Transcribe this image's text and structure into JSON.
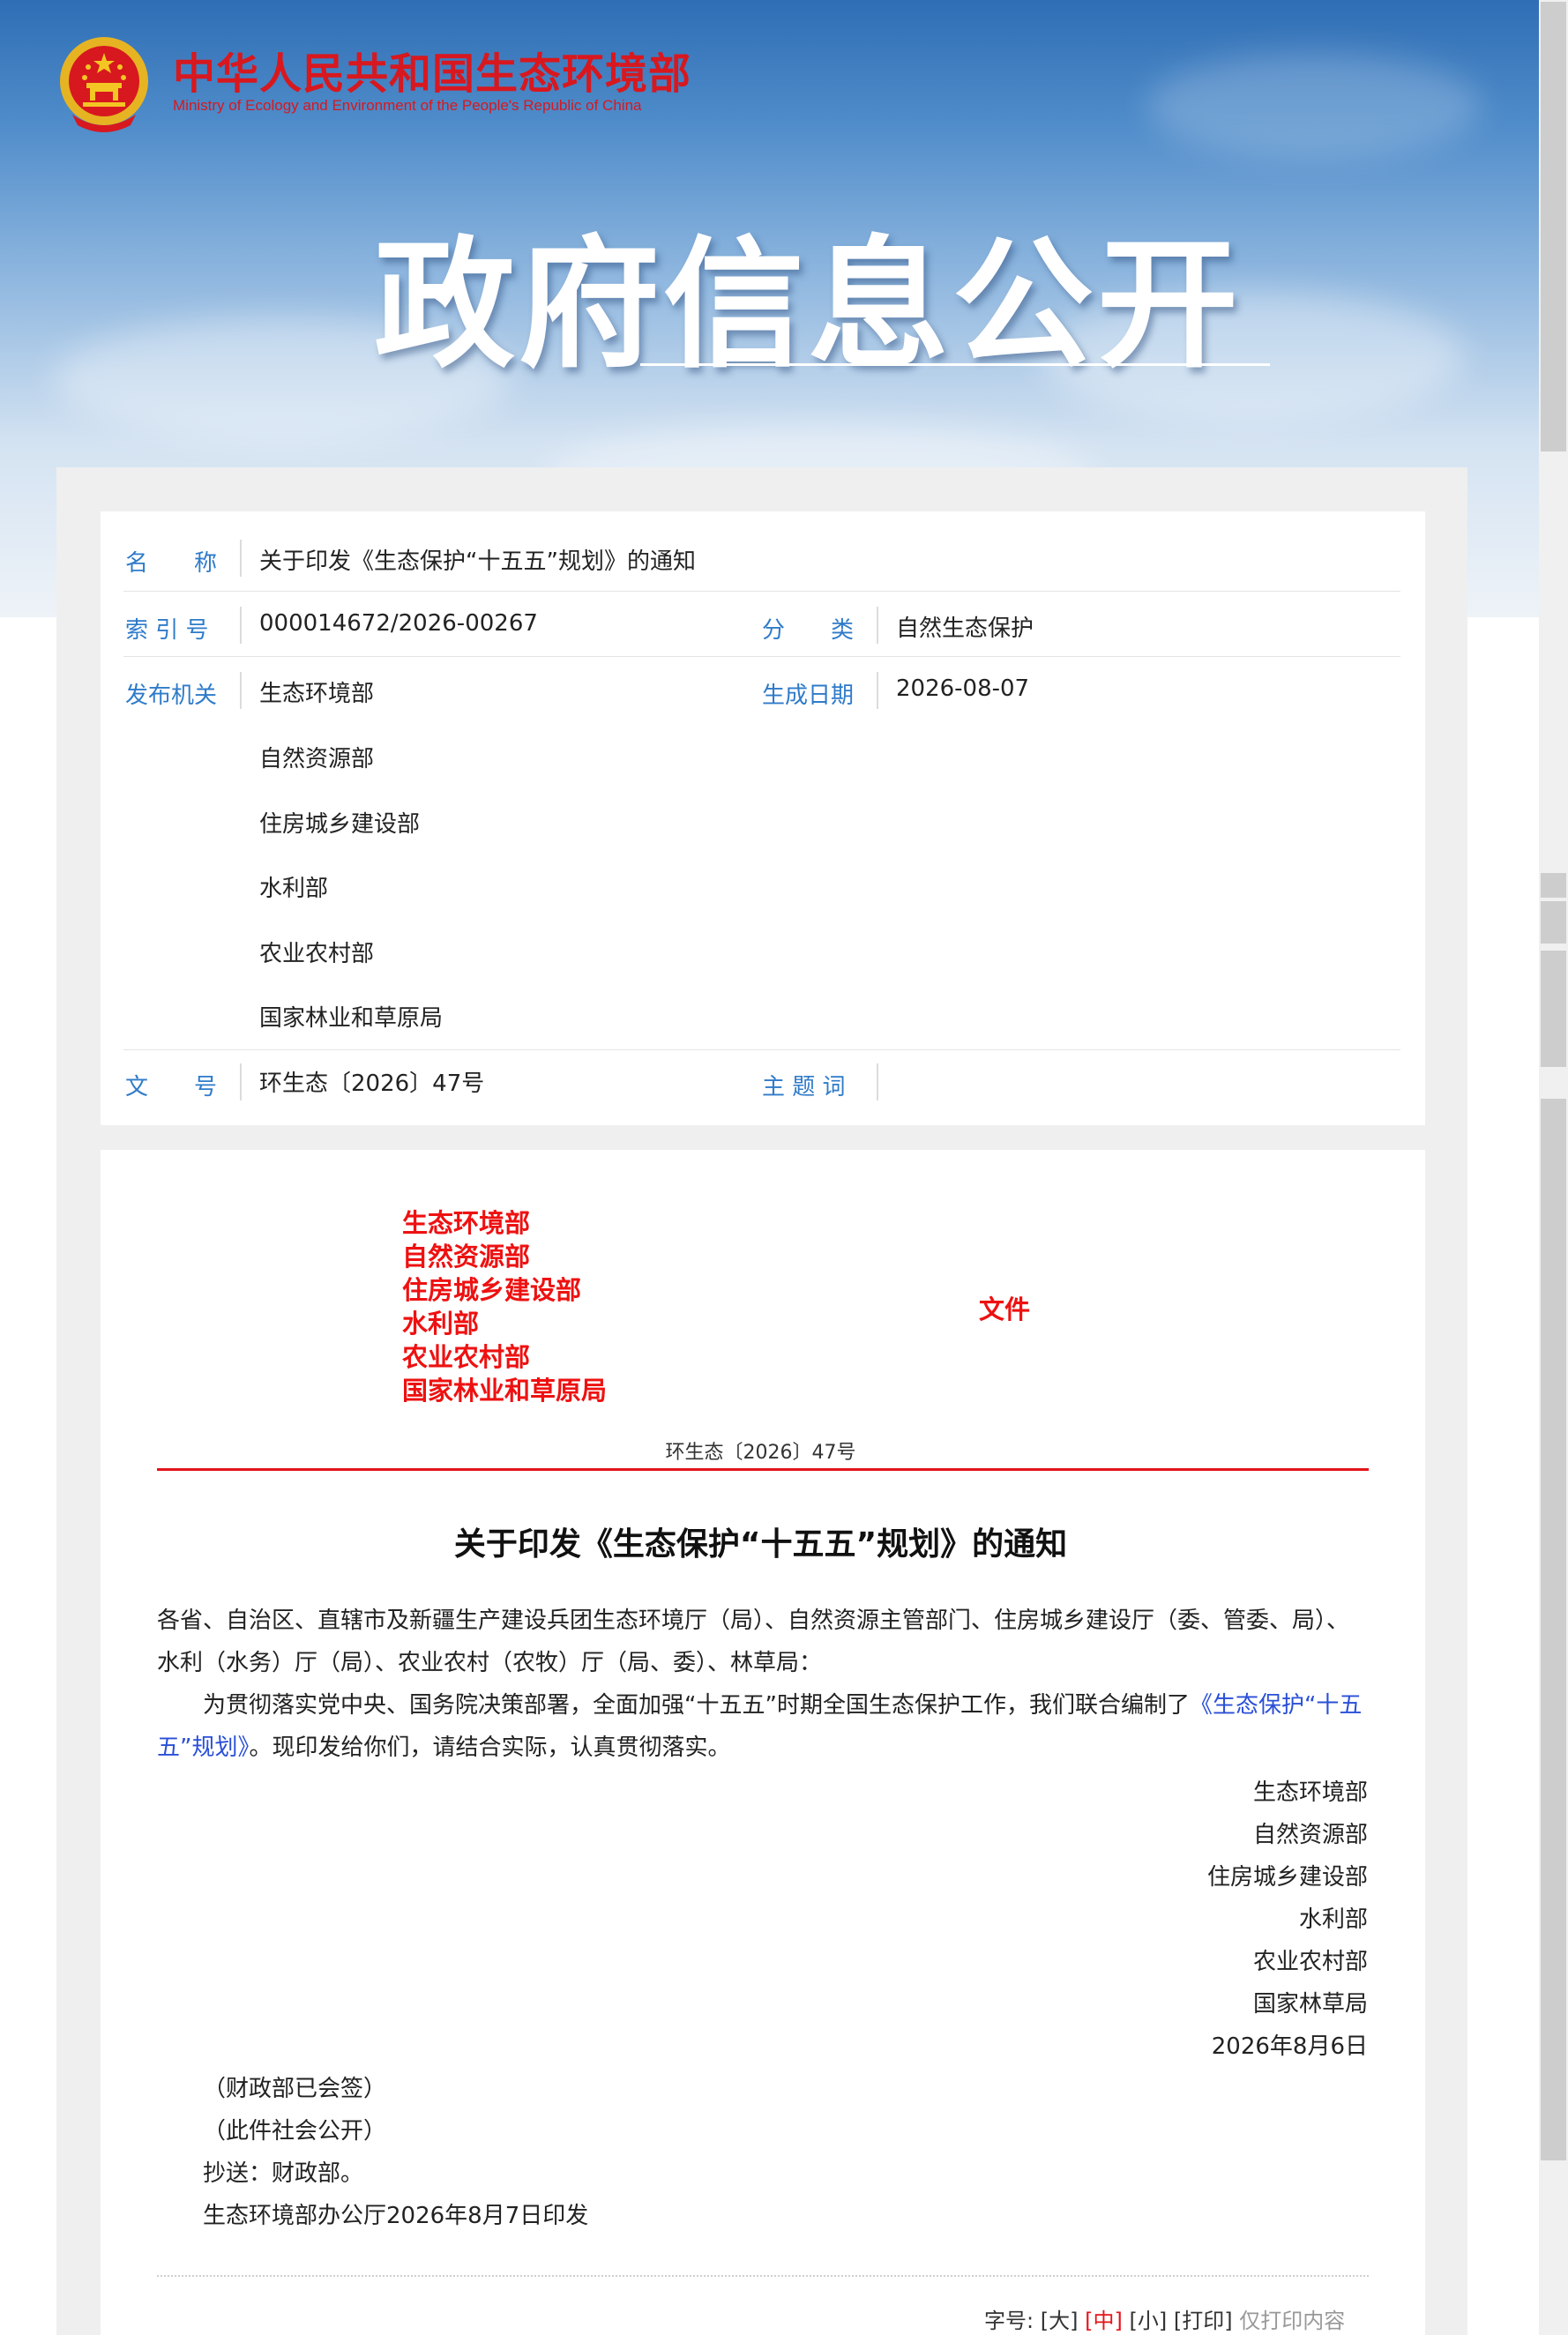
{
  "header": {
    "ministry_cn": "中华人民共和国生态环境部",
    "ministry_en": "Ministry of Ecology and Environment of the People's Republic of China",
    "hero_title": "政府信息公开"
  },
  "meta": {
    "name_label": "名　　称",
    "name_value": "关于印发《生态保护“十五五”规划》的通知",
    "index_label": "索 引 号",
    "index_value": "000014672/2026-00267",
    "category_label": "分　　类",
    "category_value": "自然生态保护",
    "issuer_label": "发布机关",
    "issuers": [
      "生态环境部",
      "自然资源部",
      "住房城乡建设部",
      "水利部",
      "农业农村部",
      "国家林业和草原局"
    ],
    "date_label": "生成日期",
    "date_value": "2026-08-07",
    "docno_label": "文　　号",
    "docno_value": "环生态〔2026〕47号",
    "keywords_label": "主 题 词",
    "keywords_value": ""
  },
  "document": {
    "issuing_orgs": [
      "生态环境部",
      "自然资源部",
      "住房城乡建设部",
      "水利部",
      "农业农村部",
      "国家林业和草原局"
    ],
    "wenjian": "文件",
    "doc_number": "环生态〔2026〕47号",
    "title": "关于印发《生态保护“十五五”规划》的通知",
    "recipients": "各省、自治区、直辖市及新疆生产建设兵团生态环境厅（局）、自然资源主管部门、住房城乡建设厅（委、管委、局）、水利（水务）厅（局）、农业农村（农牧）厅（局、委）、林草局：",
    "body_before_link": "为贯彻落实党中央、国务院决策部署，全面加强“十五五”时期全国生态保护工作，我们联合编制了",
    "body_link": "《生态保护“十五五”规划》",
    "body_after_link": "。现印发给你们，请结合实际，认真贯彻落实。",
    "signatories": [
      "生态环境部",
      "自然资源部",
      "住房城乡建设部",
      "水利部",
      "农业农村部",
      "国家林草局"
    ],
    "sign_date": "2026年8月6日",
    "notes": [
      "（财政部已会签）",
      "（此件社会公开）"
    ],
    "cc": "抄送：财政部。",
    "printed_by": "生态环境部办公厅2026年8月7日印发"
  },
  "toolbar": {
    "font_size_label": "字号:",
    "large": "[大]",
    "medium": "[中]",
    "small": "[小]",
    "print": "[打印]",
    "print_only": "仅打印内容"
  },
  "colors": {
    "accent_red": "#e4141a",
    "label_blue": "#2f7bc9",
    "link_blue": "#2a4fd7"
  }
}
